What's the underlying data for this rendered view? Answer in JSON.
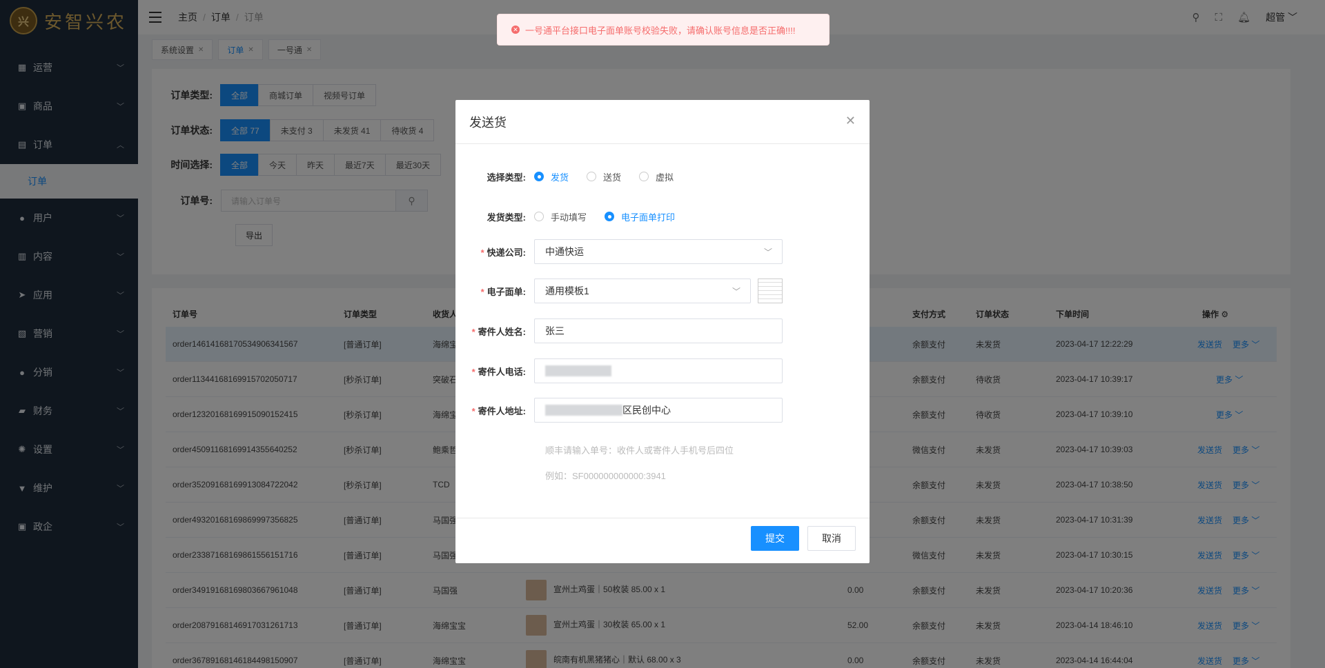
{
  "brand": {
    "logo_text": "安智兴农",
    "seal_text": "兴"
  },
  "sidebar": {
    "items": [
      {
        "label": "运营",
        "icon": "grid-icon"
      },
      {
        "label": "商品",
        "icon": "bag-icon"
      },
      {
        "label": "订单",
        "icon": "clipboard-icon"
      },
      {
        "label": "用户",
        "icon": "user-icon"
      },
      {
        "label": "内容",
        "icon": "book-icon"
      },
      {
        "label": "应用",
        "icon": "send-icon"
      },
      {
        "label": "营销",
        "icon": "chart-icon"
      },
      {
        "label": "分销",
        "icon": "person-icon"
      },
      {
        "label": "财务",
        "icon": "wallet-icon"
      },
      {
        "label": "设置",
        "icon": "gear-icon"
      },
      {
        "label": "维护",
        "icon": "tool-icon"
      },
      {
        "label": "政企",
        "icon": "briefcase-icon"
      }
    ],
    "sub_order": "订单"
  },
  "header": {
    "breadcrumb": [
      "主页",
      "订单",
      "订单"
    ],
    "user": "超管"
  },
  "tags": [
    {
      "label": "系统设置"
    },
    {
      "label": "订单"
    },
    {
      "label": "一号通"
    }
  ],
  "filters": {
    "order_type_label": "订单类型:",
    "order_type_opts": [
      "全部",
      "商城订单",
      "视频号订单"
    ],
    "status_label": "订单状态:",
    "status_opts": [
      "全部 77",
      "未支付 3",
      "未发货 41",
      "待收货 4"
    ],
    "time_label": "时间选择:",
    "time_opts": [
      "全部",
      "今天",
      "昨天",
      "最近7天",
      "最近30天"
    ],
    "order_no_label": "订单号:",
    "order_no_placeholder": "请输入订单号",
    "export": "导出"
  },
  "table": {
    "headers": {
      "order_no": "订单号",
      "type": "订单类型",
      "receiver": "收货人",
      "pay": "支付方式",
      "status": "订单状态",
      "time": "下单时间",
      "ops": "操作"
    },
    "rows": [
      {
        "order_no": "order14614168170534906341567",
        "type": "[普通订单]",
        "receiver": "海绵宝",
        "product": "",
        "amount": "",
        "pay": "余额支付",
        "status": "未发货",
        "time": "2023-04-17 12:22:29",
        "ship": "发送货",
        "more": "更多"
      },
      {
        "order_no": "order11344168169915702050717",
        "type": "[秒杀订单]",
        "receiver": "突破石",
        "product": "",
        "amount": "",
        "pay": "余额支付",
        "status": "待收货",
        "time": "2023-04-17 10:39:17",
        "ship": "",
        "more": "更多"
      },
      {
        "order_no": "order12320168169915090152415",
        "type": "[秒杀订单]",
        "receiver": "海绵宝",
        "product": "",
        "amount": "",
        "pay": "余额支付",
        "status": "待收货",
        "time": "2023-04-17 10:39:10",
        "ship": "",
        "more": "更多"
      },
      {
        "order_no": "order45091168169914355640252",
        "type": "[秒杀订单]",
        "receiver": "鲍乘哲",
        "product": "",
        "amount": "",
        "pay": "微信支付",
        "status": "未发货",
        "time": "2023-04-17 10:39:03",
        "ship": "发送货",
        "more": "更多"
      },
      {
        "order_no": "order35209168169913084722042",
        "type": "[秒杀订单]",
        "receiver": "TCD",
        "product": "",
        "amount": "",
        "pay": "余额支付",
        "status": "未发货",
        "time": "2023-04-17 10:38:50",
        "ship": "发送货",
        "more": "更多"
      },
      {
        "order_no": "order49320168169869997356825",
        "type": "[普通订单]",
        "receiver": "马国强",
        "product": "",
        "amount": "",
        "pay": "余额支付",
        "status": "未发货",
        "time": "2023-04-17 10:31:39",
        "ship": "发送货",
        "more": "更多"
      },
      {
        "order_no": "order23387168169861556151716",
        "type": "[普通订单]",
        "receiver": "马国强",
        "product": "",
        "amount": "",
        "pay": "微信支付",
        "status": "未发货",
        "time": "2023-04-17 10:30:15",
        "ship": "发送货",
        "more": "更多"
      },
      {
        "order_no": "order34919168169803667961048",
        "type": "[普通订单]",
        "receiver": "马国强",
        "product": "宣州土鸡蛋｜50枚装   85.00 x 1",
        "amount": "0.00",
        "pay": "余额支付",
        "status": "未发货",
        "time": "2023-04-17 10:20:36",
        "ship": "发送货",
        "more": "更多"
      },
      {
        "order_no": "order20879168146917031261713",
        "type": "[普通订单]",
        "receiver": "海绵宝宝",
        "product": "宣州土鸡蛋｜30枚装   65.00 x 1",
        "amount": "52.00",
        "pay": "余额支付",
        "status": "未发货",
        "time": "2023-04-14 18:46:10",
        "ship": "发送货",
        "more": "更多"
      },
      {
        "order_no": "order36789168146184498150907",
        "type": "[普通订单]",
        "receiver": "海绵宝宝",
        "product": "皖南有机黑猪猪心｜默认   68.00 x 3",
        "amount": "0.00",
        "pay": "余额支付",
        "status": "未发货",
        "time": "2023-04-14 16:44:04",
        "ship": "发送货",
        "more": "更多"
      }
    ]
  },
  "toast": {
    "message": "一号通平台接口电子面单账号校验失败，请确认账号信息是否正确!!!!"
  },
  "dialog": {
    "title": "发送货",
    "select_type_label": "选择类型:",
    "select_type_opts": [
      "发货",
      "送货",
      "虚拟"
    ],
    "ship_type_label": "发货类型:",
    "ship_type_opts": [
      "手动填写",
      "电子面单打印"
    ],
    "courier_label": "快递公司:",
    "courier_value": "中通快运",
    "waybill_label": "电子面单:",
    "waybill_value": "通用模板1",
    "sender_name_label": "寄件人姓名:",
    "sender_name_value": "张三",
    "sender_phone_label": "寄件人电话:",
    "sender_addr_label": "寄件人地址:",
    "sender_addr_value": "区民创中心",
    "hint1": "顺丰请输入单号：收件人或寄件人手机号后四位",
    "hint2": "例如：SF000000000000:3941",
    "submit": "提交",
    "cancel": "取消"
  },
  "colors": {
    "primary": "#1890ff",
    "sidebar_bg": "#1f2d3d",
    "error": "#f56c6c"
  }
}
